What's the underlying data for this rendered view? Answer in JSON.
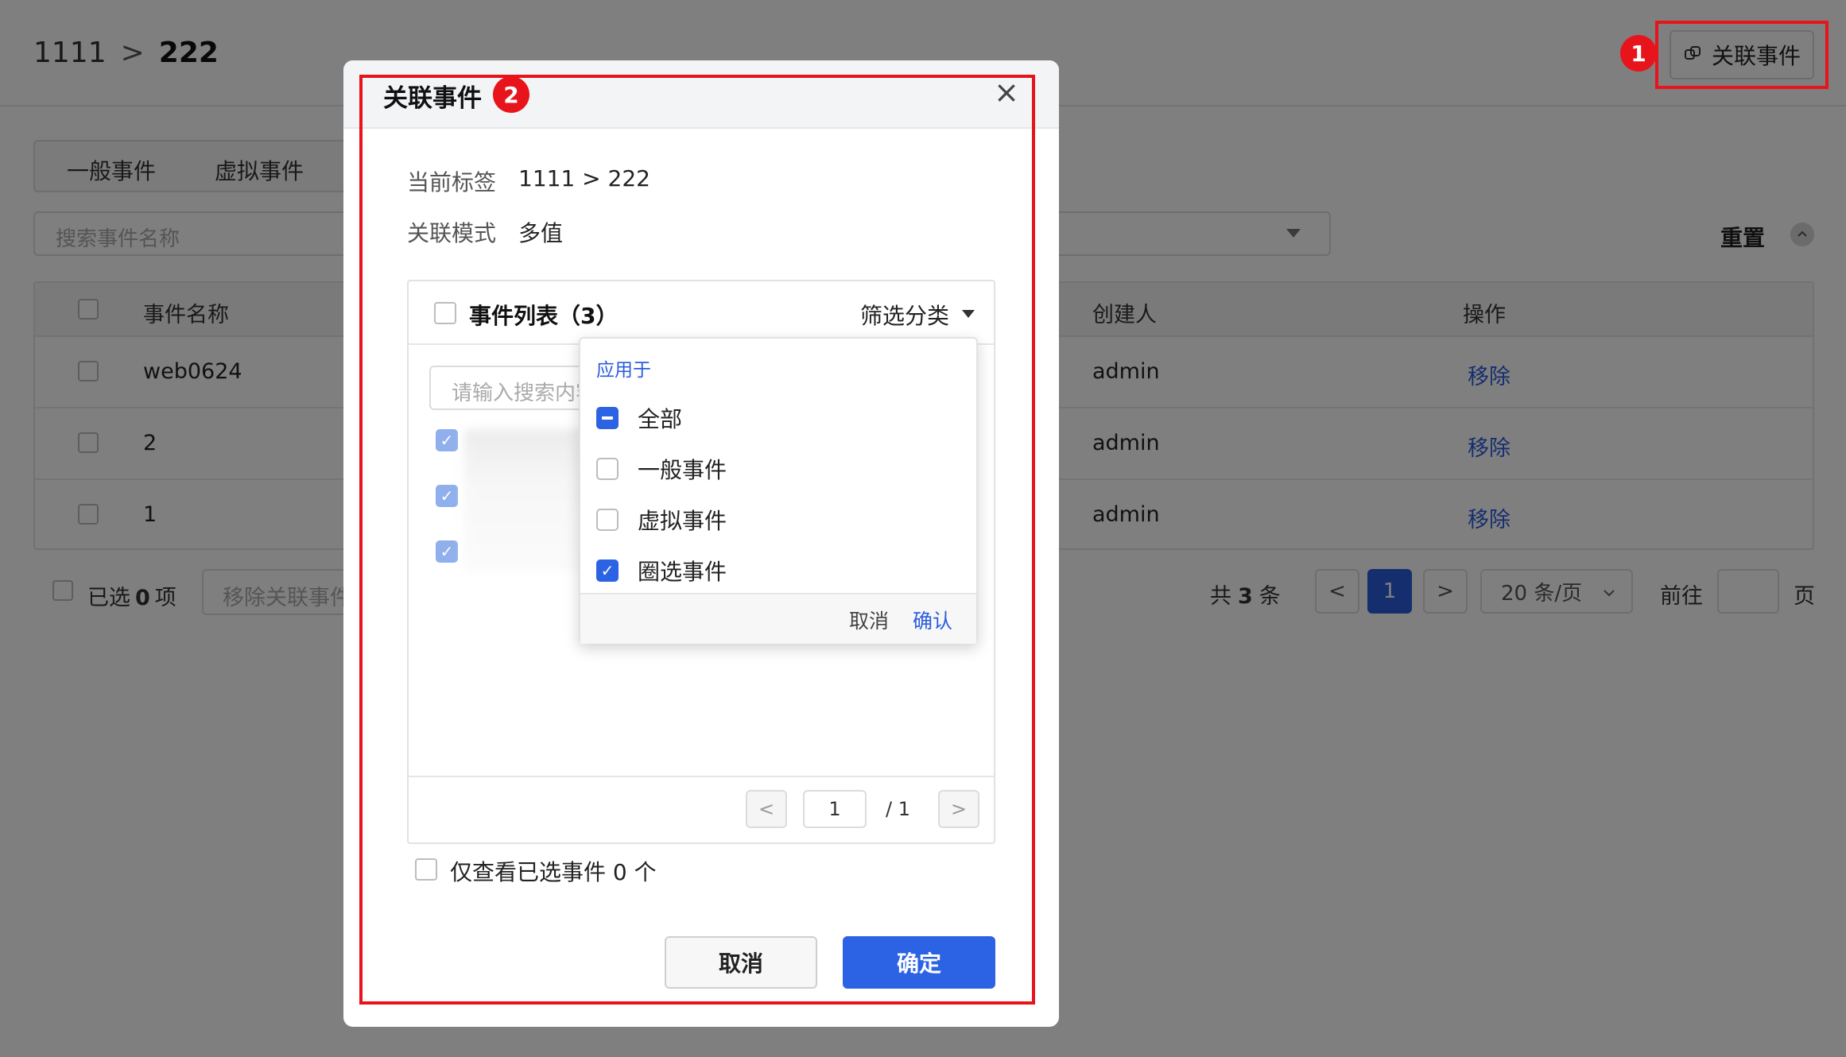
{
  "header": {
    "breadcrumb": {
      "parent": "1111",
      "separator": ">",
      "current": "222"
    },
    "link_event_button": "关联事件",
    "link_icon": "link-icon"
  },
  "tabs": [
    "一般事件",
    "虚拟事件"
  ],
  "filter": {
    "search_placeholder": "搜索事件名称",
    "reset": "重置",
    "collapse_icon": "chevron-up-icon"
  },
  "table": {
    "columns": {
      "name": "事件名称",
      "creator": "创建人",
      "action": "操作"
    },
    "rows": [
      {
        "name": "web0624",
        "creator": "admin",
        "action": "移除"
      },
      {
        "name": "2",
        "creator": "admin",
        "action": "移除"
      },
      {
        "name": "1",
        "creator": "admin",
        "action": "移除"
      }
    ]
  },
  "footer": {
    "selected_prefix": "已选",
    "selected_count": "0",
    "selected_suffix": "项",
    "remove_button": "移除关联事件",
    "total_prefix": "共",
    "total_count": "3",
    "total_suffix": "条",
    "prev_icon": "<",
    "current_page": "1",
    "next_icon": ">",
    "page_size": "20 条/页",
    "page_size_icon": "chevron-down-icon",
    "goto_label": "前往",
    "goto_value": "",
    "goto_suffix": "页"
  },
  "modal": {
    "title": "关联事件",
    "close_icon": "×",
    "current_tag_label": "当前标签",
    "current_tag_value": "1111 > 222",
    "mode_label": "关联模式",
    "mode_value": "多值",
    "panel": {
      "title": "事件列表（3）",
      "filter_label": "筛选分类",
      "search_placeholder": "请输入搜索内容",
      "checked_items": 3,
      "pagination": {
        "prev": "<",
        "page": "1",
        "total": "/ 1",
        "next": ">"
      }
    },
    "only_selected": "仅查看已选事件 0 个",
    "cancel": "取消",
    "confirm": "确定"
  },
  "dropdown": {
    "group_label": "应用于",
    "options": [
      {
        "label": "全部",
        "state": "indeterminate"
      },
      {
        "label": "一般事件",
        "state": "unchecked"
      },
      {
        "label": "虚拟事件",
        "state": "unchecked"
      },
      {
        "label": "圈选事件",
        "state": "checked"
      }
    ],
    "cancel": "取消",
    "confirm": "确认"
  },
  "annotations": {
    "badge_1": "1",
    "badge_2": "2",
    "highlight_color": "#e8141c"
  },
  "colors": {
    "primary": "#2b63e4",
    "link": "#2b5cdd",
    "annotation": "#e8141c"
  }
}
